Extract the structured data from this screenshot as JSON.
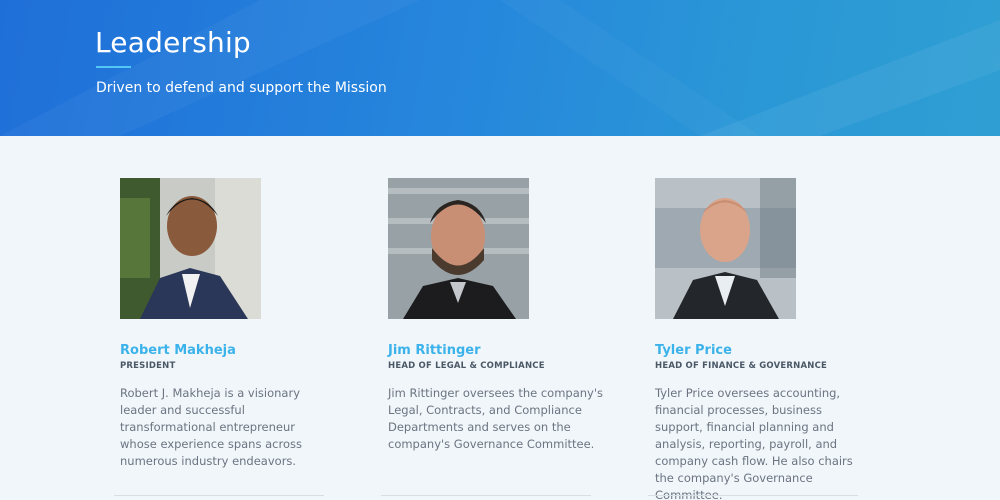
{
  "header": {
    "title": "Leadership",
    "subtitle": "Driven to defend and support the Mission"
  },
  "leaders": [
    {
      "name": "Robert Makheja",
      "role": "PRESIDENT",
      "bio": "Robert J. Makheja is a visionary leader and successful transformational entrepreneur whose experience spans across numerous industry endeavors."
    },
    {
      "name": "Jim Rittinger",
      "role": "HEAD OF LEGAL & COMPLIANCE",
      "bio": "Jim Rittinger oversees the company's Legal, Contracts, and Compliance Departments and serves on the company's Governance Committee."
    },
    {
      "name": "Tyler Price",
      "role": "HEAD OF FINANCE & GOVERNANCE",
      "bio": "Tyler Price oversees accounting, financial processes, business support, financial planning and analysis, reporting, payroll, and company cash flow. He also chairs the company's Governance Committee."
    }
  ],
  "colors": {
    "hero_start": "#1f6fd8",
    "hero_end": "#2f9fd3",
    "accent": "#3bb3ea",
    "page_bg": "#f1f6fb"
  }
}
